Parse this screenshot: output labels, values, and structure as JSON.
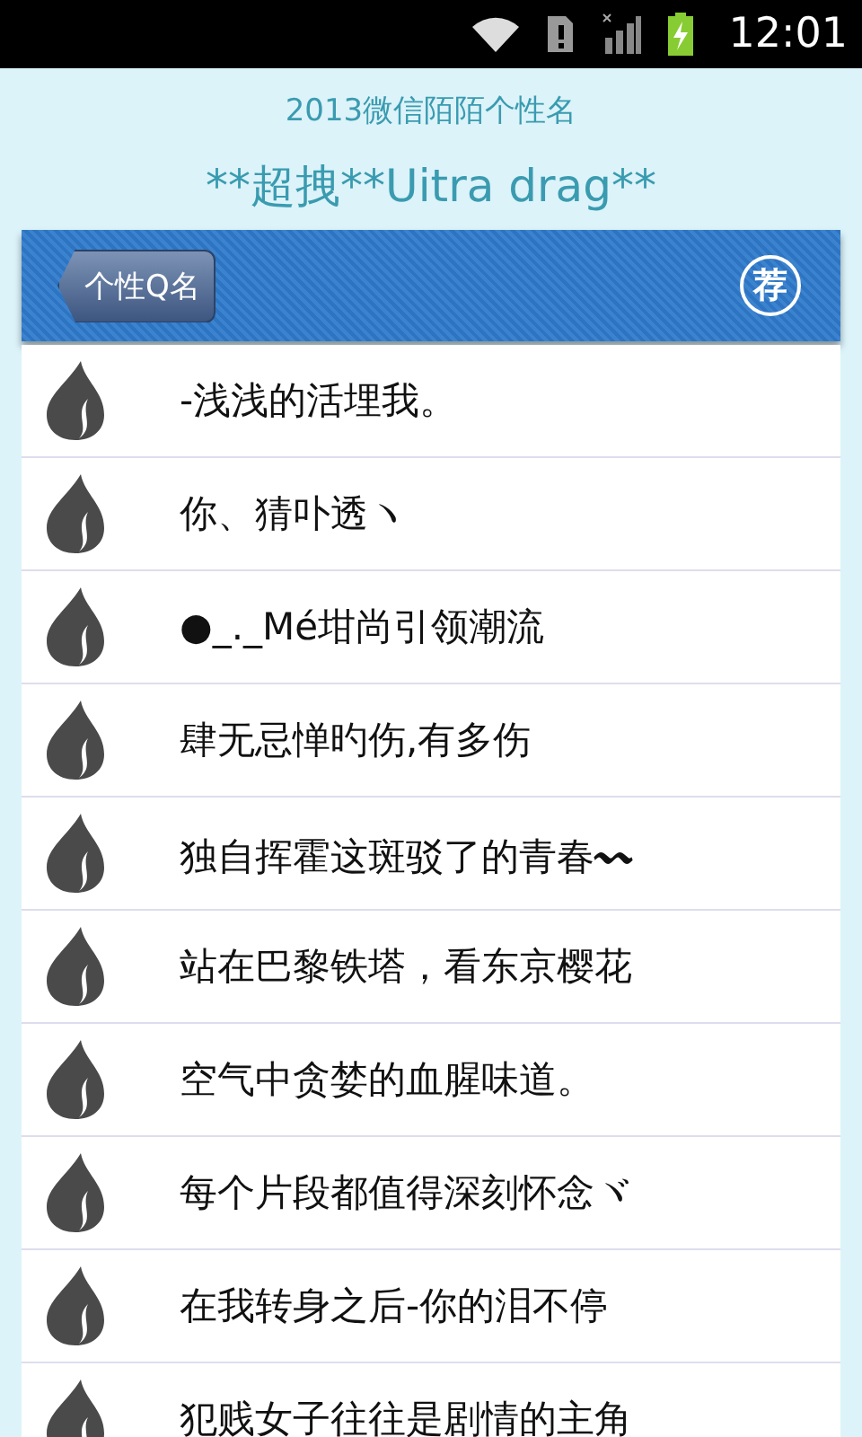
{
  "status_bar": {
    "time": "12:01"
  },
  "header": {
    "subtitle": "2013微信陌陌个性名",
    "title": "**超拽**Uitra drag**"
  },
  "nav_bar": {
    "back_button": "个性Q名",
    "badge": "荐"
  },
  "names": [
    {
      "text": "-浅浅的活埋我。"
    },
    {
      "text": "你、猜卟透ヽ"
    },
    {
      "text": "●_._Mé坩尚引领潮流"
    },
    {
      "text": "肆无忌惮旳伤,有多伤"
    },
    {
      "text": "独自挥霍这斑驳了的青春〰"
    },
    {
      "text": "站在巴黎铁塔，看东京樱花"
    },
    {
      "text": "空气中贪婪的血腥味道。"
    },
    {
      "text": "每个片段都值得深刻怀念ヾ"
    },
    {
      "text": "在我转身之后-你的泪不停"
    },
    {
      "text": "犯贱女子往往是剧情的主角"
    }
  ]
}
